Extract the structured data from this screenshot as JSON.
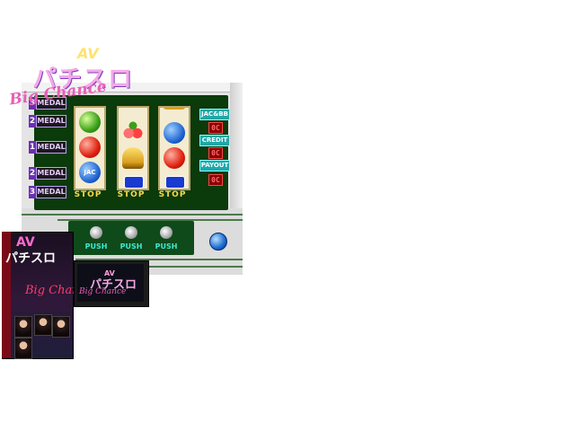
{
  "title": {
    "av": "AV",
    "main": "パチスロ",
    "sub": "Big Chance"
  },
  "medals": [
    {
      "num": "3",
      "label": "MEDAL"
    },
    {
      "num": "2",
      "label": "MEDAL"
    },
    {
      "num": "1",
      "label": "MEDAL"
    },
    {
      "num": "2",
      "label": "MEDAL"
    },
    {
      "num": "3",
      "label": "MEDAL"
    }
  ],
  "reels": [
    {
      "symbols": [
        "apple",
        "tomato",
        "jac"
      ]
    },
    {
      "symbols": [
        "cherry",
        "bell",
        "bar"
      ]
    },
    {
      "symbols": [
        "blue-orb",
        "blue-orb",
        "tomato"
      ]
    }
  ],
  "stop_labels": [
    "STOP",
    "STOP",
    "STOP"
  ],
  "info": {
    "jac_bb_label": "JAC&BB",
    "jac_bb_value": "0C",
    "credit_label": "CREDIT",
    "credit_value": "0C",
    "payout_label": "PAYOUT",
    "payout_value": "0C"
  },
  "jac_symbol_text": "JAC",
  "push_labels": [
    "PUSH",
    "PUSH",
    "PUSH"
  ],
  "box": {
    "av": "AV",
    "title": "パチスロ",
    "sub": "Big Chance"
  },
  "cartridge": {
    "av": "AV",
    "title": "パチスロ",
    "sub": "Big Chance"
  },
  "colors": {
    "panel": "#0b3a0b",
    "stop": "#ffd84a",
    "push": "#3ee8d0",
    "info": "#1fa8a8",
    "value": "#8a0000"
  }
}
